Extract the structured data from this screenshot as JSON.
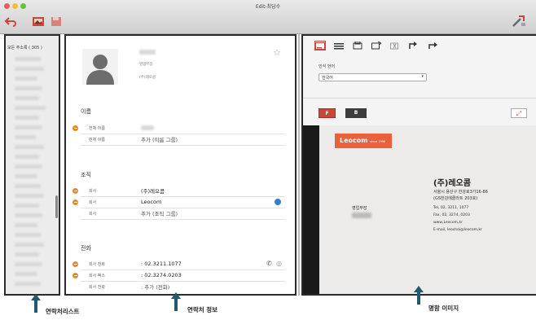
{
  "window": {
    "title": "Edit-최담수"
  },
  "contact_list": {
    "header": "모든 주소록 ( 305 )"
  },
  "contact_info": {
    "name_blurred": "",
    "subtitle_position": "영업부장",
    "subtitle_company": "(주)레오콤",
    "sections": {
      "name": {
        "title": "이름",
        "rows": [
          {
            "label": "전체 이름",
            "value": ""
          },
          {
            "label": "전체 이름",
            "value": "추가 (이름 그룹)"
          }
        ]
      },
      "org": {
        "title": "조직",
        "rows": [
          {
            "label": "회사",
            "value": "(주)레오콤"
          },
          {
            "label": "회사",
            "value": "Leocom"
          },
          {
            "label": "회사",
            "value": "추가 (조직 그룹)"
          }
        ]
      },
      "phone": {
        "title": "전화",
        "rows": [
          {
            "label": "회사 전화",
            "value": ": 02.3211.1077"
          },
          {
            "label": "회사 팩스",
            "value": ": 02.3274.0203"
          },
          {
            "label": "회사 전화",
            "value": ": 추가 (전화)"
          }
        ]
      }
    }
  },
  "card_panel": {
    "recog_lang_label": "인식 언어",
    "recog_lang_value": "한국어",
    "front_label": "F",
    "back_label": "B",
    "card": {
      "brand": "Leocom",
      "since": "since 1998",
      "company": "(주)레오콤",
      "address1": "서울시 용산구 한강로3가16-86",
      "address2": "(GS한강에클라트 203호)",
      "title": "영업부장",
      "tel": "Tel, 02, 3211, 1077",
      "fax": "Fax, 02, 3274, 0203",
      "web": "www,Leocom,kr",
      "email": "E-mail, leochoi@leocom,kr"
    }
  },
  "annotations": {
    "list_label": "연락처리스트",
    "info_label": "연락처 정보",
    "card_label": "명함 이미지"
  },
  "colors": {
    "accent_orange": "#e58a1d",
    "toolbar_red": "#d9443a",
    "arrow_teal": "#1f5a6e",
    "card_orange": "#e8613a",
    "card_background": "#1a1a1a"
  }
}
